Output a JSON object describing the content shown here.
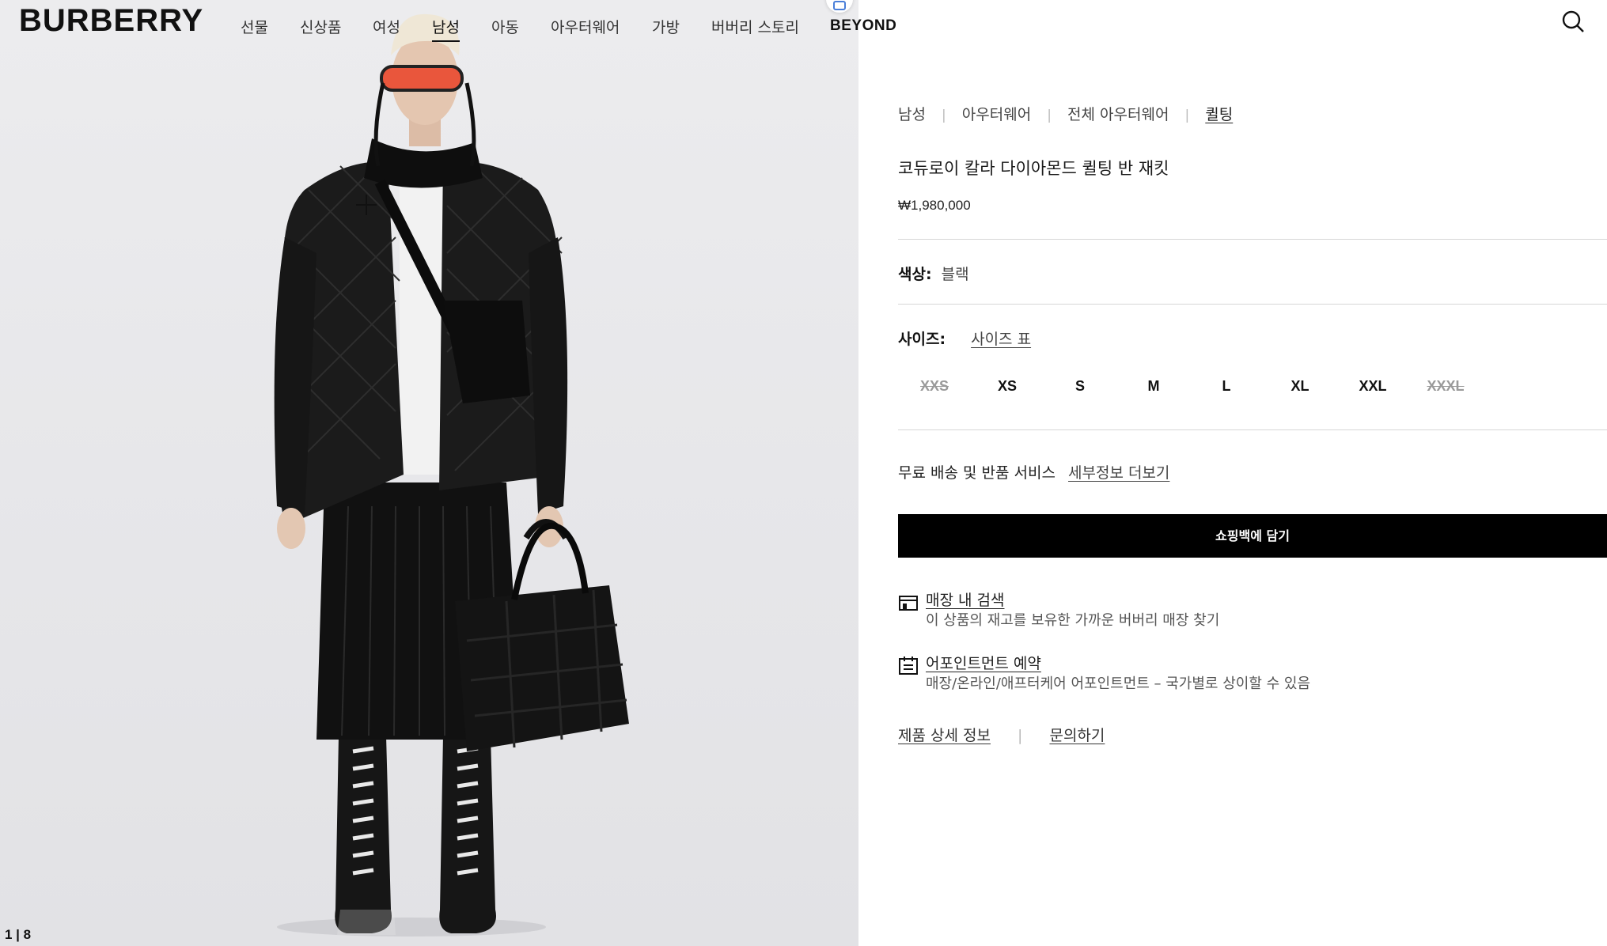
{
  "brand": {
    "logo_text": "BURBERRY"
  },
  "nav": {
    "items": [
      {
        "label": "선물"
      },
      {
        "label": "신상품"
      },
      {
        "label": "여성"
      },
      {
        "label": "남성",
        "active": true
      },
      {
        "label": "아동"
      },
      {
        "label": "아우터웨어"
      },
      {
        "label": "가방"
      },
      {
        "label": "버버리 스토리"
      },
      {
        "label": "BEYOND"
      }
    ],
    "search_icon": "search-icon"
  },
  "gallery": {
    "counter": "1 | 8"
  },
  "product": {
    "breadcrumb": [
      "남성",
      "아우터웨어",
      "전체 아우터웨어",
      "퀼팅"
    ],
    "title": "코듀로이 칼라 다이아몬드 퀼팅 반 재킷",
    "price": "₩1,980,000",
    "color_label": "색상:",
    "color_value": "블랙",
    "size_label": "사이즈:",
    "size_guide": "사이즈 표",
    "sizes": [
      {
        "label": "XXS",
        "available": false
      },
      {
        "label": "XS",
        "available": true
      },
      {
        "label": "S",
        "available": true
      },
      {
        "label": "M",
        "available": true
      },
      {
        "label": "L",
        "available": true
      },
      {
        "label": "XL",
        "available": true
      },
      {
        "label": "XXL",
        "available": true
      },
      {
        "label": "XXXL",
        "available": false
      }
    ],
    "shipping_text": "무료 배송 및 반품 서비스",
    "shipping_link": "세부정보 더보기",
    "add_to_bag": "쇼핑백에 담기",
    "services": [
      {
        "icon": "store-icon",
        "title": "매장 내 검색",
        "desc": "이 상품의 재고를 보유한 가까운 버버리 매장 찾기"
      },
      {
        "icon": "calendar-icon",
        "title": "어포인트먼트 예약",
        "desc": "매장/온라인/애프터케어 어포인트먼트 – 국가별로 상이할 수 있음"
      }
    ],
    "footer_links": [
      "제품 상세 정보",
      "문의하기"
    ]
  },
  "colors": {
    "accent": "#000000",
    "page_bg": "#ffffff",
    "image_bg": "#e8e8eb"
  }
}
